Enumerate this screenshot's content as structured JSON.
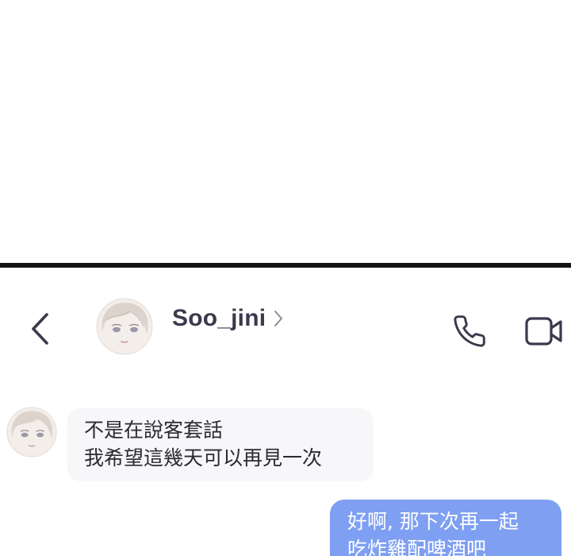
{
  "header": {
    "back_icon": "chevron-left-icon",
    "contact_name": "Soo_jini",
    "profile_chevron_icon": "chevron-right-icon",
    "call_icon": "phone-icon",
    "video_icon": "video-camera-icon"
  },
  "messages": [
    {
      "direction": "incoming",
      "lines": [
        "不是在說客套話",
        "我希望這幾天可以再見一次"
      ]
    },
    {
      "direction": "outgoing",
      "lines": [
        "好啊, 那下次再一起",
        "吃炸雞配啤酒吧"
      ]
    }
  ],
  "colors": {
    "divider": "#141414",
    "icon": "#3a3a4c",
    "incoming_bubble": "#f7f7f9",
    "outgoing_bubble": "#7e9ff2",
    "outgoing_text": "#ffffff"
  }
}
